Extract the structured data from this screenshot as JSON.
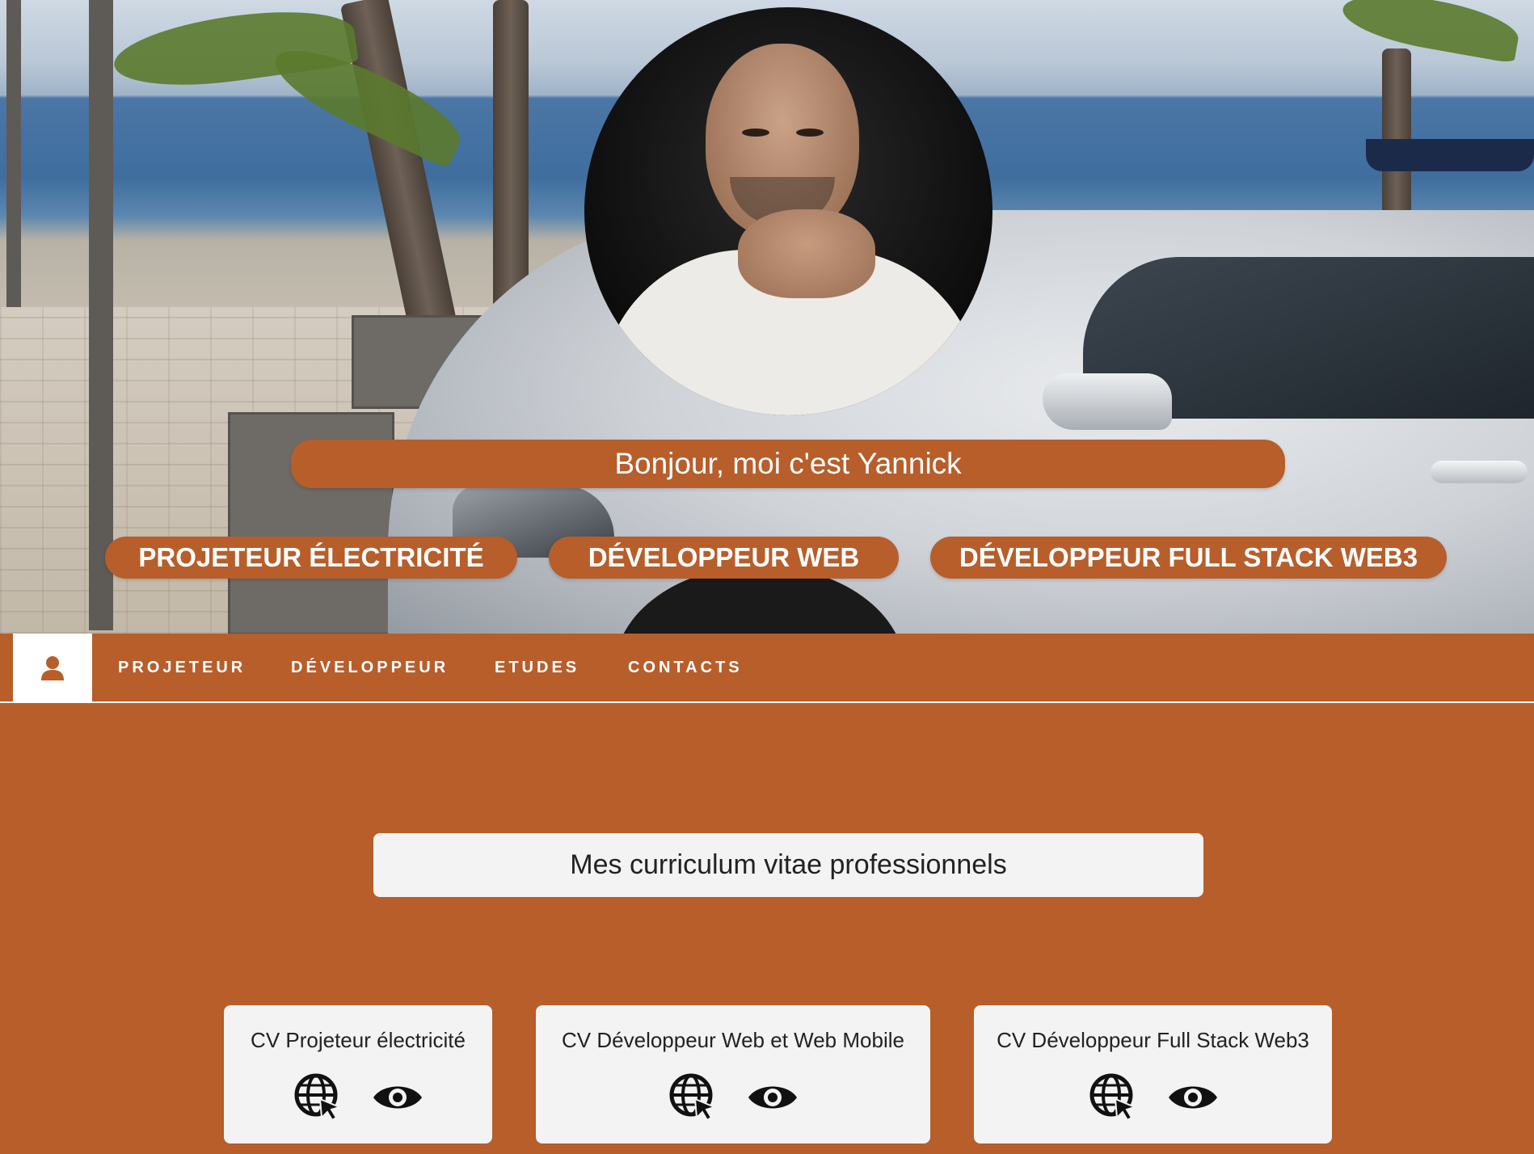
{
  "hero": {
    "greeting": "Bonjour, moi c'est Yannick",
    "roles": [
      {
        "label": "PROJETEUR ÉLECTRICITÉ"
      },
      {
        "label": "DÉVELOPPEUR WEB"
      },
      {
        "label": "DÉVELOPPEUR FULL STACK WEB3"
      }
    ],
    "avatar_icon": "profile-photo"
  },
  "nav": {
    "home_icon": "user-icon",
    "links": [
      {
        "label": "PROJETEUR"
      },
      {
        "label": "DÉVELOPPEUR"
      },
      {
        "label": "ETUDES"
      },
      {
        "label": "CONTACTS"
      }
    ]
  },
  "main": {
    "section_title": "Mes curriculum vitae professionnels",
    "cards": [
      {
        "title": "CV Projeteur électricité",
        "icons": [
          "globe-cursor-icon",
          "eye-icon"
        ]
      },
      {
        "title": "CV Développeur Web et Web Mobile",
        "icons": [
          "globe-cursor-icon",
          "eye-icon"
        ]
      },
      {
        "title": "CV Développeur Full Stack Web3",
        "icons": [
          "globe-cursor-icon",
          "eye-icon"
        ]
      }
    ]
  },
  "colors": {
    "accent": "#b75e2b",
    "card_bg": "#f3f3f3",
    "text_dark": "#222222",
    "text_light": "#ffffff"
  }
}
